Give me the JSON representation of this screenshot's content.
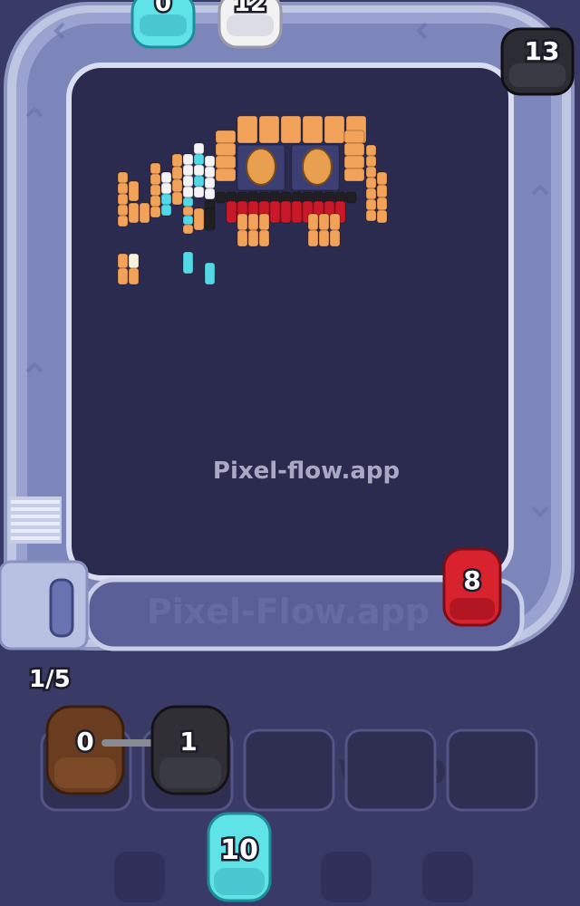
{
  "watermark": {
    "center": "Pixel-flow.app",
    "conveyor": "Pixel-Flow.app",
    "slots": "Flow.app"
  },
  "top_units": [
    {
      "color": "#5fe3e6",
      "count": "0"
    },
    {
      "color": "#f2f2f2",
      "count": "12"
    }
  ],
  "track_units": [
    {
      "color": "#2c2c34",
      "count": "13"
    },
    {
      "color": "#d8232f",
      "count": "8"
    }
  ],
  "queue_counter": "1/5",
  "slots": [
    {
      "color": "#6b3d20",
      "count": "0"
    },
    {
      "color": "#2f2f35",
      "count": "1"
    },
    {
      "color": null,
      "count": null
    },
    {
      "color": null,
      "count": null
    },
    {
      "color": null,
      "count": null
    }
  ],
  "next_unit": {
    "color": "#5fe3e6",
    "count": "10"
  },
  "colors": {
    "background": "#3a3a66",
    "track": "#c7cde6",
    "board": "#2b2a4f",
    "orange": "#f3a25a",
    "red": "#c9182a",
    "cyan": "#54d7e6",
    "white": "#f4f4f6",
    "black": "#1f1f24"
  }
}
